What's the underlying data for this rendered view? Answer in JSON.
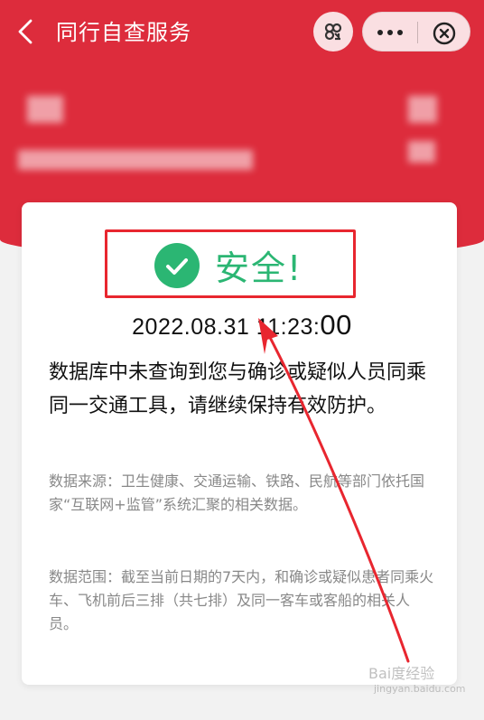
{
  "header": {
    "title": "同行自查服务",
    "icons": {
      "back": "back-chevron-icon",
      "scan": "scan-icon",
      "more": "more-dots-icon",
      "close": "close-circle-icon"
    },
    "colors": {
      "background": "#dd2c3c",
      "text": "#ffffff"
    }
  },
  "result": {
    "status": "安全!",
    "status_color": "#2bb673",
    "icon": "check-circle-icon",
    "timestamp_main": "2022.08.31 11:23:",
    "timestamp_seconds": "00"
  },
  "message": "数据库中未查询到您与确诊或疑似人员同乘同一交通工具，请继续保持有效防护。",
  "notes": {
    "source": "数据来源：卫生健康、交通运输、铁路、民航等部门依托国家“互联网+监管”系统汇聚的相关数据。",
    "scope": "数据范围：截至当前日期的7天内，和确诊或疑似患者同乘火车、飞机前后三排（共七排）及同一客车或客船的相关人员。"
  },
  "annotation": {
    "highlight_color": "#e8262f",
    "arrow_color": "#e8262f"
  },
  "watermark": {
    "text": "Bai度经验",
    "sub": "jingyan.baidu.com"
  }
}
